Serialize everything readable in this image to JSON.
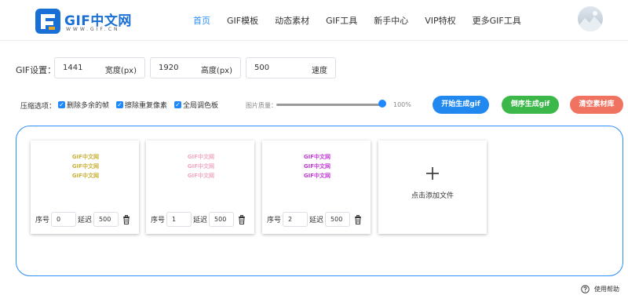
{
  "header": {
    "logo": {
      "text": "GIF中文网",
      "sub": "WWW.GIF.CN"
    },
    "nav": [
      {
        "label": "首页",
        "active": true
      },
      {
        "label": "GIF模板",
        "active": false
      },
      {
        "label": "动态素材",
        "active": false
      },
      {
        "label": "GIF工具",
        "active": false
      },
      {
        "label": "新手中心",
        "active": false
      },
      {
        "label": "VIP特权",
        "active": false
      },
      {
        "label": "更多GIF工具",
        "active": false
      }
    ]
  },
  "settings": {
    "label": "GIF设置：",
    "width": {
      "value": "1441",
      "unit": "宽度(px)"
    },
    "height": {
      "value": "1920",
      "unit": "高度(px)"
    },
    "speed": {
      "value": "500",
      "unit": "速度"
    }
  },
  "options": {
    "label": "压缩选项：",
    "checkboxes": [
      {
        "label": "删除多余的帧",
        "checked": true
      },
      {
        "label": "擦除重复像素",
        "checked": true
      },
      {
        "label": "全局调色板",
        "checked": true
      }
    ],
    "quality_label": "图片质量：",
    "quality_value": "100%",
    "quality_fraction": 1.0
  },
  "buttons": {
    "generate": {
      "label": "开始生成gif",
      "color": "#2188f0"
    },
    "reverse": {
      "label": "倒序生成gif",
      "color": "#3cb84a"
    },
    "clear": {
      "label": "清空素材库",
      "color": "#f07362"
    }
  },
  "frames": [
    {
      "text": "GIF中文网",
      "color": "#c9b13a",
      "seq_label": "序号",
      "seq": "0",
      "delay_label": "延迟",
      "delay": "500"
    },
    {
      "text": "GIF中文网",
      "color": "#f2a9c4",
      "seq_label": "序号",
      "seq": "1",
      "delay_label": "延迟",
      "delay": "500"
    },
    {
      "text": "GIF中文网",
      "color": "#c23ad6",
      "seq_label": "序号",
      "seq": "2",
      "delay_label": "延迟",
      "delay": "500"
    }
  ],
  "add_file": {
    "label": "点击添加文件"
  },
  "help": {
    "label": "使用帮助"
  },
  "colors": {
    "accent": "#2c8ef8"
  }
}
